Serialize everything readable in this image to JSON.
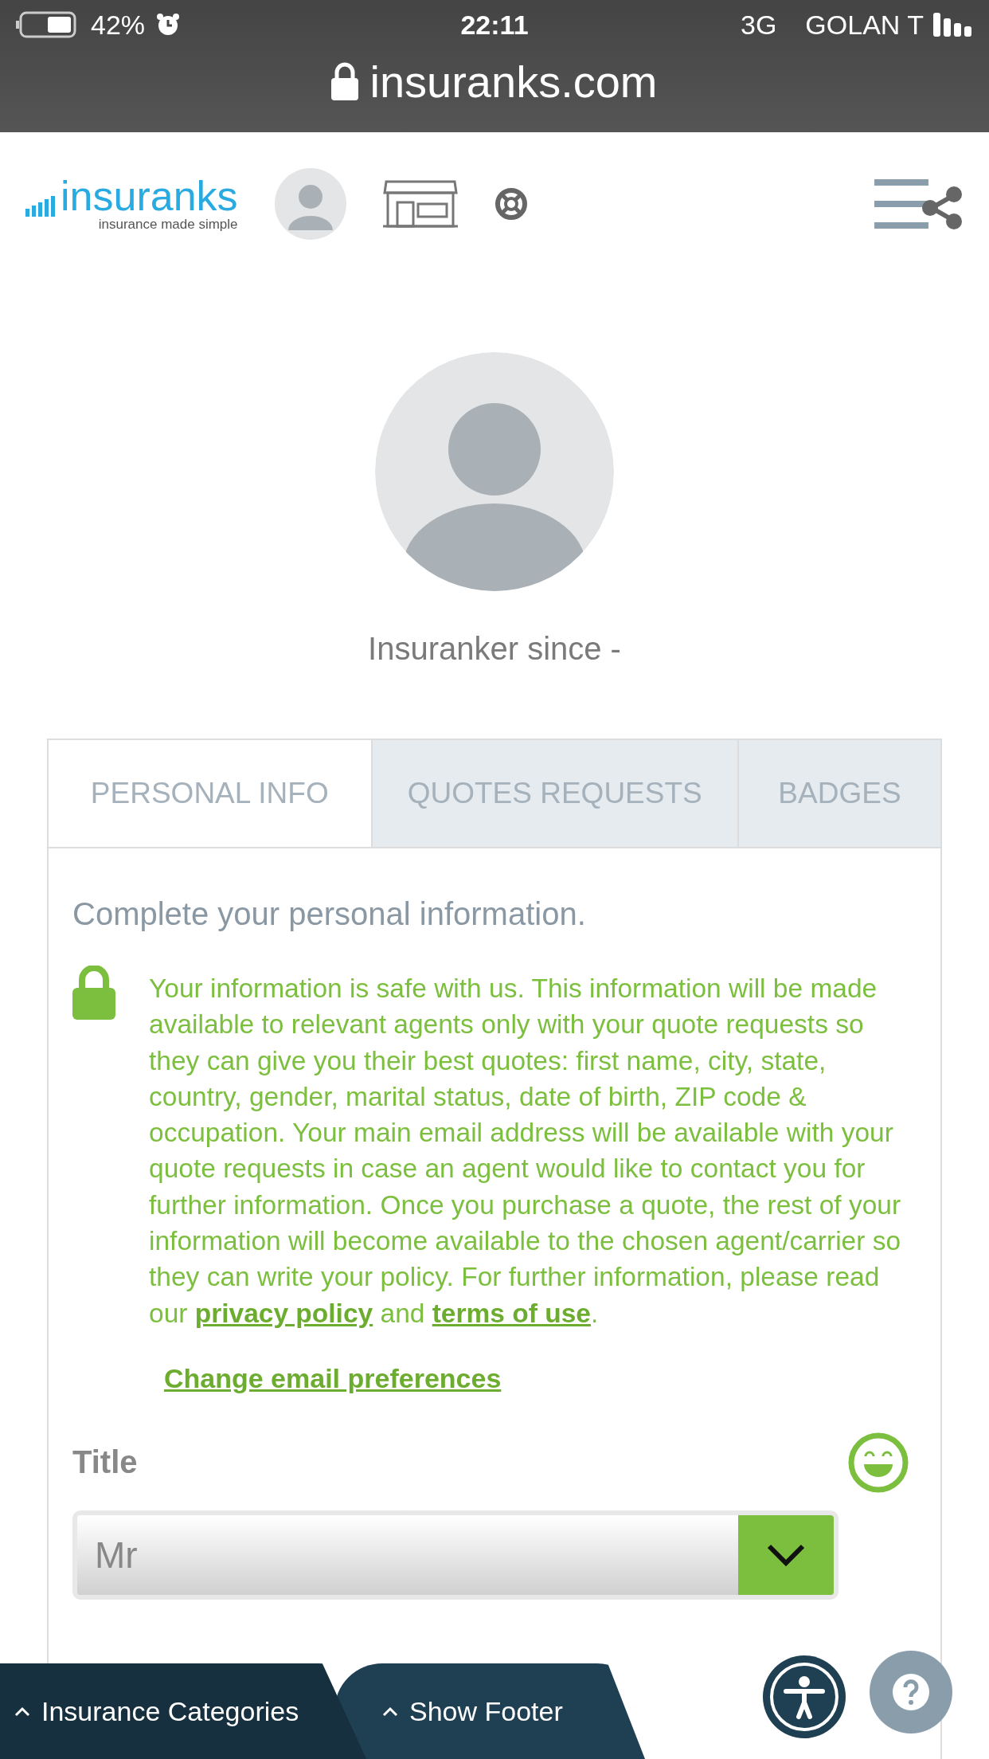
{
  "status_bar": {
    "battery": "42%",
    "time": "22:11",
    "network": "3G",
    "carrier": "GOLAN T"
  },
  "address_bar": {
    "url": "insuranks.com"
  },
  "header": {
    "logo": "insuranks",
    "tagline": "insurance made simple"
  },
  "profile": {
    "since": "Insuranker since -"
  },
  "tabs": [
    {
      "label": "PERSONAL INFO",
      "selected": true
    },
    {
      "label": "QUOTES REQUESTS",
      "selected": false
    },
    {
      "label": "BADGES",
      "selected": false
    }
  ],
  "intro": "Complete your personal information.",
  "notice": [
    {
      "kind": "text",
      "text": "Your information is safe with us. This information will be made available to relevant agents only with your quote requests so they can give you their best quotes: first name, city, state, country, gender, marital status, date of birth, ZIP code & occupation. Your main email address will be available with your quote requests in case an agent would like to contact you for further information. Once you purchase a quote, the rest of your information will become available to the chosen agent/carrier so they can write your policy. For further information, please read our "
    },
    {
      "kind": "link",
      "text": "privacy policy"
    },
    {
      "kind": "text",
      "text": " and "
    },
    {
      "kind": "link",
      "text": "terms of use"
    },
    {
      "kind": "text",
      "text": "."
    }
  ],
  "email_link": "Change email preferences",
  "title_field": {
    "label": "Title",
    "value": "Mr"
  },
  "footer_tabs": [
    {
      "label": "Insurance Categories"
    },
    {
      "label": "Show Footer"
    }
  ]
}
